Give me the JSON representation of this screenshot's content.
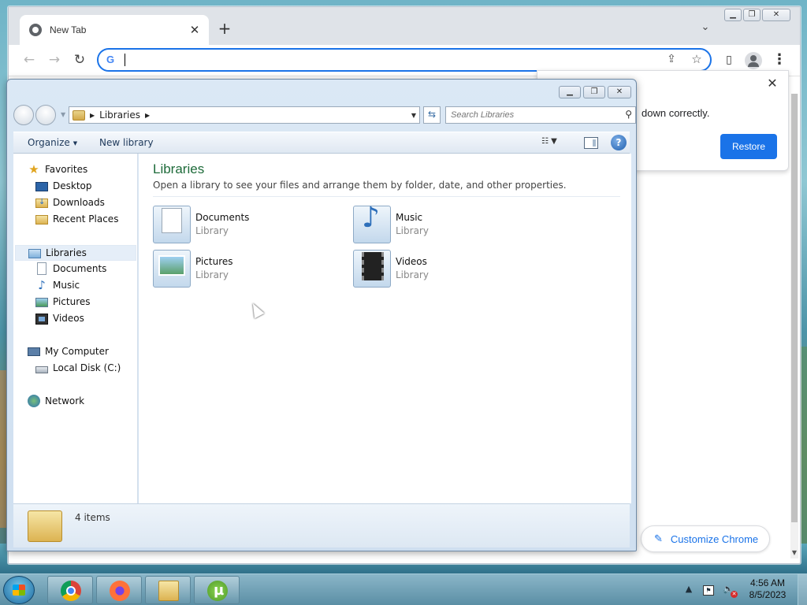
{
  "chrome": {
    "tab_title": "New Tab",
    "omnibox_value": "",
    "bubble_message": "down correctly.",
    "restore_label": "Restore",
    "customize_label": "Customize Chrome"
  },
  "explorer": {
    "breadcrumb": [
      "Libraries"
    ],
    "search_placeholder": "Search Libraries",
    "commands": {
      "organize": "Organize",
      "new_library": "New library"
    },
    "nav": {
      "favorites": {
        "label": "Favorites",
        "items": [
          "Desktop",
          "Downloads",
          "Recent Places"
        ]
      },
      "libraries": {
        "label": "Libraries",
        "items": [
          "Documents",
          "Music",
          "Pictures",
          "Videos"
        ]
      },
      "computer": {
        "label": "My Computer",
        "items": [
          "Local Disk (C:)"
        ]
      },
      "network": {
        "label": "Network"
      }
    },
    "content": {
      "title": "Libraries",
      "description": "Open a library to see your files and arrange them by folder, date, and other properties.",
      "tiles": [
        {
          "name": "Documents",
          "type": "Library",
          "icon": "documents-library-icon"
        },
        {
          "name": "Music",
          "type": "Library",
          "icon": "music-library-icon"
        },
        {
          "name": "Pictures",
          "type": "Library",
          "icon": "pictures-library-icon"
        },
        {
          "name": "Videos",
          "type": "Library",
          "icon": "videos-library-icon"
        }
      ]
    },
    "status": {
      "item_count": "4 items"
    }
  },
  "taskbar": {
    "apps": [
      "chrome-icon",
      "firefox-icon",
      "file-explorer-icon",
      "utorrent-icon"
    ],
    "clock": {
      "time": "4:56 AM",
      "date": "8/5/2023"
    }
  },
  "colors": {
    "accent": "#1a73e8",
    "library_title": "#1e6b3a"
  }
}
